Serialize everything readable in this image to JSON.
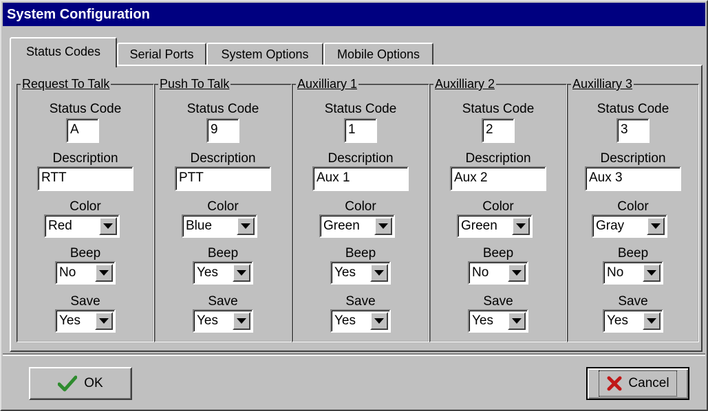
{
  "window": {
    "title": "System Configuration"
  },
  "tabs": [
    {
      "label": "Status Codes",
      "active": true
    },
    {
      "label": "Serial Ports",
      "active": false
    },
    {
      "label": "System Options",
      "active": false
    },
    {
      "label": "Mobile Options",
      "active": false
    }
  ],
  "labels": {
    "status_code": "Status Code",
    "description": "Description",
    "color": "Color",
    "beep": "Beep",
    "save": "Save"
  },
  "groups": [
    {
      "title": "Request To Talk",
      "status_code": "A",
      "description": "RTT",
      "color": "Red",
      "beep": "No",
      "save": "Yes"
    },
    {
      "title": "Push To Talk",
      "status_code": "9",
      "description": "PTT",
      "color": "Blue",
      "beep": "Yes",
      "save": "Yes"
    },
    {
      "title": "Auxilliary 1",
      "status_code": "1",
      "description": "Aux 1",
      "color": "Green",
      "beep": "Yes",
      "save": "Yes"
    },
    {
      "title": "Auxilliary 2",
      "status_code": "2",
      "description": "Aux 2",
      "color": "Green",
      "beep": "No",
      "save": "Yes"
    },
    {
      "title": "Auxilliary 3",
      "status_code": "3",
      "description": "Aux 3",
      "color": "Gray",
      "beep": "No",
      "save": "Yes"
    }
  ],
  "buttons": {
    "ok": "OK",
    "cancel": "Cancel"
  },
  "colors": {
    "titlebar": "#000080",
    "face": "#c0c0c0",
    "ok_check": "#2e8b2e",
    "cancel_x": "#c01818"
  }
}
